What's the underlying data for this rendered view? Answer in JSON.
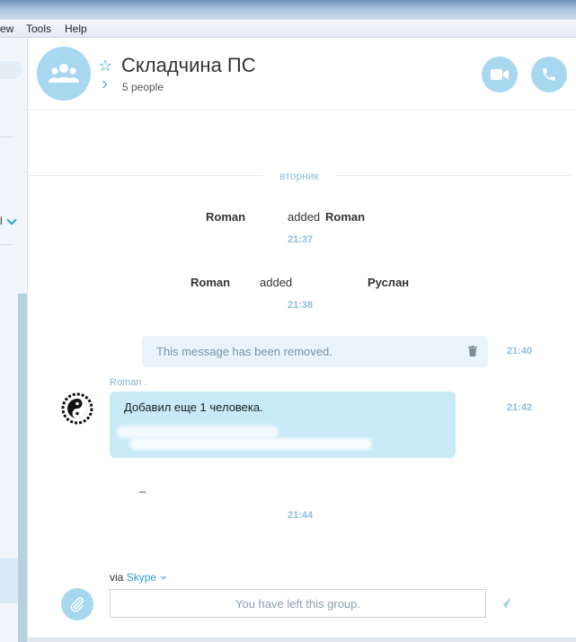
{
  "menu": {
    "view": "ew",
    "tools": "Tools",
    "help": "Help"
  },
  "sidebar": {
    "dropdown_label": "l"
  },
  "header": {
    "title": "Складчина ПС",
    "people": "5 people"
  },
  "chat": {
    "day_separator": "вторник",
    "events": [
      {
        "actor": "Roman",
        "verb": "added",
        "target": "Roman",
        "time": "21:37"
      },
      {
        "actor": "Roman",
        "verb": "added",
        "target": "Руслан",
        "time": "21:38"
      }
    ],
    "removed_message": {
      "text": "This message has been removed.",
      "time": "21:40"
    },
    "message": {
      "sender": "Roman .",
      "text": "Добавил еще 1 человека.",
      "time": "21:42"
    },
    "dash": "_",
    "last_time": "21:44"
  },
  "composer": {
    "via_label": "via",
    "via_link": "Skype",
    "placeholder": "You have left this group."
  },
  "colors": {
    "accent": "#2aa0d8",
    "bubble": "#c7e9f8",
    "icon_bg": "#a8d8ef",
    "time": "#8cbfd9"
  }
}
